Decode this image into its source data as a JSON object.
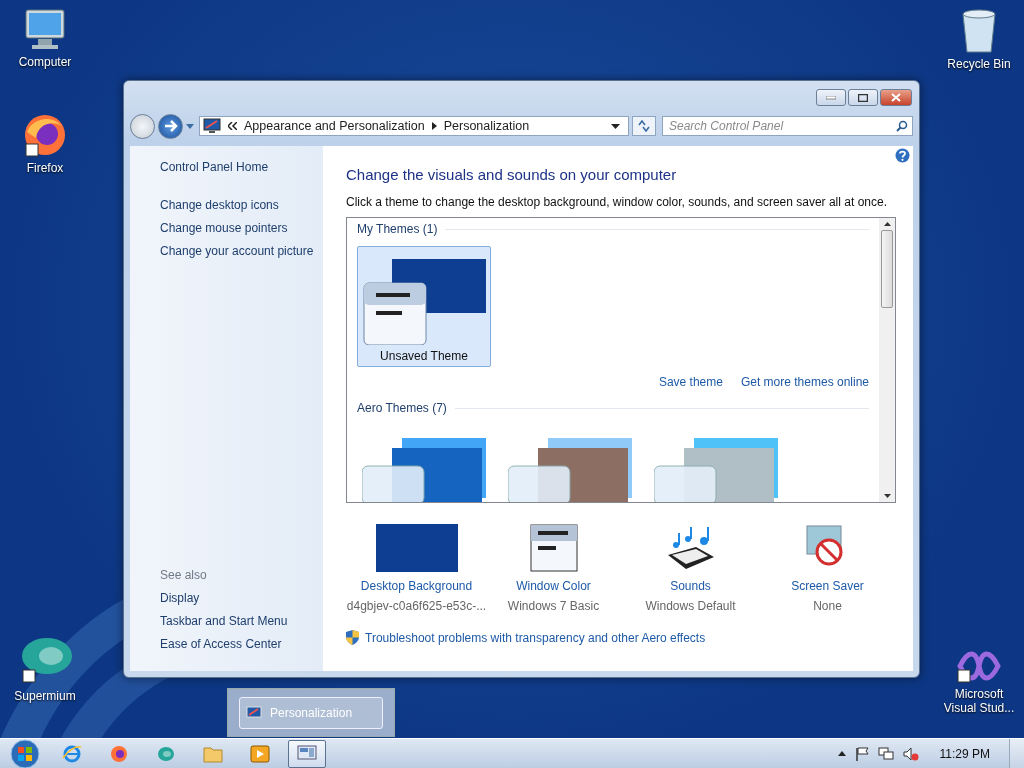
{
  "desktop_icons": [
    {
      "kind": "computer",
      "label": "Computer"
    },
    {
      "kind": "firefox",
      "label": "Firefox"
    },
    {
      "kind": "supermium",
      "label": "Supermium"
    },
    {
      "kind": "recycle",
      "label": "Recycle Bin"
    },
    {
      "kind": "vstudio",
      "label": "Microsoft Visual Stud..."
    }
  ],
  "window": {
    "breadcrumb": [
      "Appearance and Personalization",
      "Personalization"
    ],
    "search": {
      "placeholder": "Search Control Panel"
    },
    "sidebar": {
      "home": "Control Panel Home",
      "links": [
        "Change desktop icons",
        "Change mouse pointers",
        "Change your account picture"
      ],
      "see_also_heading": "See also",
      "see_also": [
        "Display",
        "Taskbar and Start Menu",
        "Ease of Access Center"
      ]
    },
    "title": "Change the visuals and sounds on your computer",
    "description": "Click a theme to change the desktop background, window color, sounds, and screen saver all at once.",
    "theme_groups": [
      {
        "heading": "My Themes (1)",
        "themes": [
          {
            "kind": "unsaved",
            "label": "Unsaved Theme",
            "selected": true
          }
        ],
        "actions": [
          "Save theme",
          "Get more themes online"
        ]
      },
      {
        "heading": "Aero Themes (7)",
        "themes": [
          {
            "kind": "windows7",
            "selected": false
          },
          {
            "kind": "architecture",
            "selected": false
          },
          {
            "kind": "characters",
            "selected": false
          }
        ]
      }
    ],
    "settings": [
      {
        "kind": "background",
        "label": "Desktop Background",
        "value": "d4gbjev-c0a6f625-e53c-..."
      },
      {
        "kind": "color",
        "label": "Window Color",
        "value": "Windows 7 Basic"
      },
      {
        "kind": "sounds",
        "label": "Sounds",
        "value": "Windows Default"
      },
      {
        "kind": "screensaver",
        "label": "Screen Saver",
        "value": "None"
      }
    ],
    "troubleshoot": "Troubleshoot problems with transparency and other Aero effects"
  },
  "taskbar": {
    "preview": "Personalization",
    "apps": [
      {
        "kind": "ie",
        "selected": false
      },
      {
        "kind": "firefox",
        "selected": false
      },
      {
        "kind": "supermium",
        "selected": false
      },
      {
        "kind": "explorer",
        "selected": false
      },
      {
        "kind": "media",
        "selected": false
      },
      {
        "kind": "control",
        "selected": true
      }
    ],
    "clock": "11:29 PM"
  }
}
